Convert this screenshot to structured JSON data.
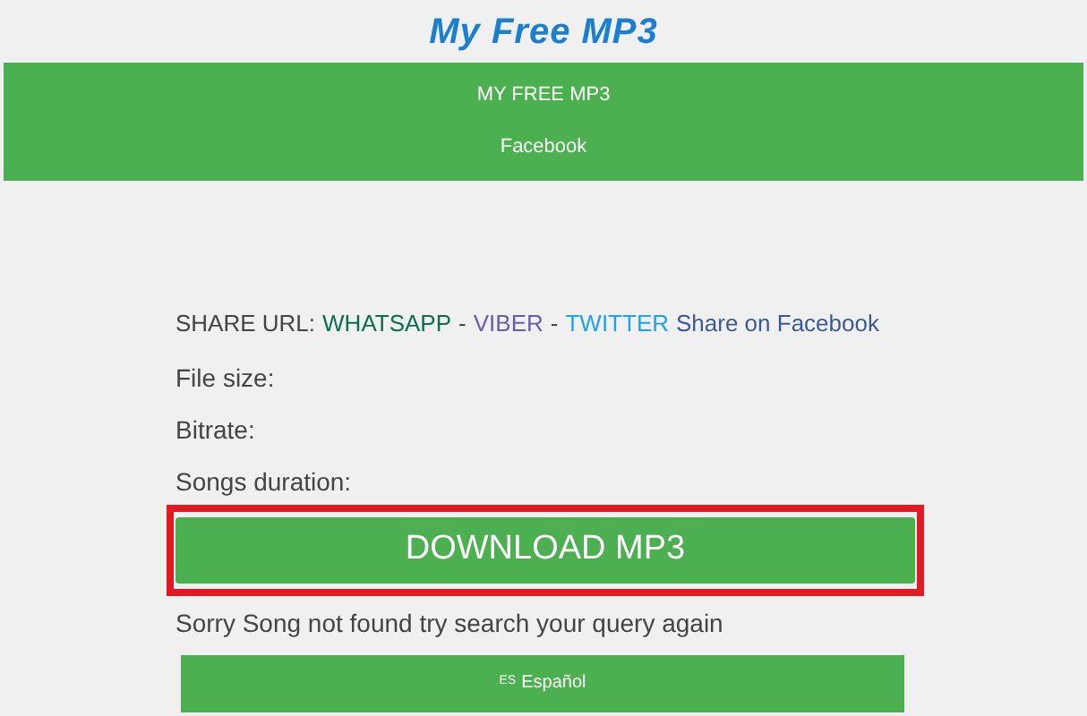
{
  "logo": "My Free MP3",
  "nav": [
    "MY FREE MP3",
    "Facebook"
  ],
  "share": {
    "label": "SHARE URL:",
    "links": [
      {
        "text": "WHATSAPP",
        "color": "#0b6e4f"
      },
      {
        "text": "VIBER",
        "color": "#6a5aa8"
      },
      {
        "text": "TWITTER",
        "color": "#1da1f2"
      }
    ],
    "separator": "-",
    "facebook": "Share on Facebook"
  },
  "info": [
    "File size:",
    "Bitrate:",
    "Songs duration:"
  ],
  "download": {
    "label": "DOWNLOAD MP3",
    "highlighted": true
  },
  "message": "Sorry Song not found try search your query again",
  "language": {
    "code": "ES",
    "label": "Español"
  }
}
